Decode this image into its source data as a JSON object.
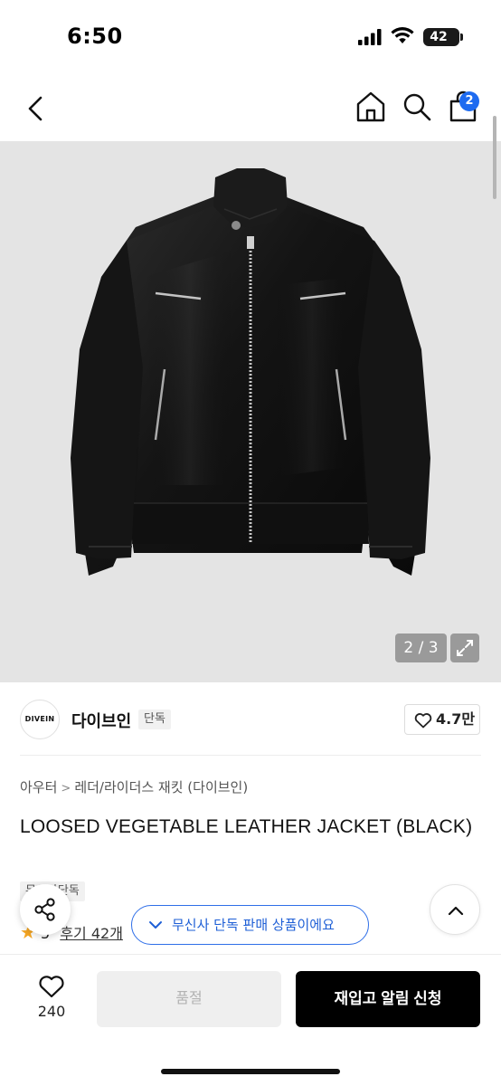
{
  "status_bar": {
    "time": "6:50",
    "battery": "42"
  },
  "header": {
    "back_icon": "chevron-left-icon",
    "home_icon": "home-icon",
    "search_icon": "search-icon",
    "cart_icon": "bag-icon",
    "cart_badge": "2",
    "badge_color": "#1e6bf0"
  },
  "gallery": {
    "counter": "2 / 3",
    "expand_icon": "expand-icon",
    "background": "#e4e4e4"
  },
  "brand": {
    "logo_text": "DIVEIN",
    "name": "다이브인",
    "tag": "단독",
    "like_count": "4.7만"
  },
  "breadcrumb": {
    "category": "아우터",
    "subcategory": "레더/라이더스 재킷 (다이브인)"
  },
  "product": {
    "title": "LOOSED VEGETABLE LEATHER JACKET (BLACK)",
    "exclusive_tag": "무신사단독",
    "rating": "5",
    "reviews": "후기 42개"
  },
  "toast": {
    "text": "무신사 단독 판매 상품이에요",
    "color": "#2f6fe8"
  },
  "bottom_bar": {
    "wish_count": "240",
    "soldout_label": "품절",
    "restock_label": "재입고 알림 신청"
  }
}
